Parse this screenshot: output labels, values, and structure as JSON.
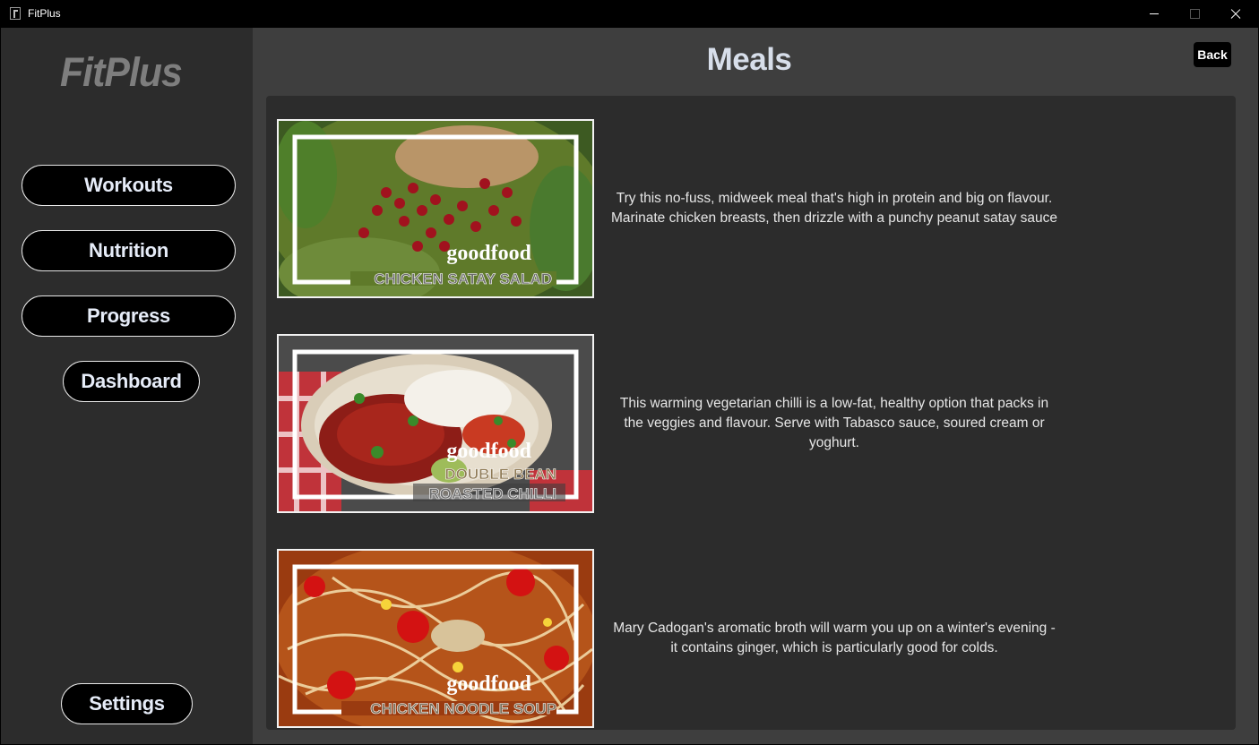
{
  "window": {
    "title": "FitPlus"
  },
  "sidebar": {
    "logo": "FitPlus",
    "items": [
      {
        "label": "Workouts"
      },
      {
        "label": "Nutrition"
      },
      {
        "label": "Progress"
      },
      {
        "label": "Dashboard"
      }
    ],
    "settings_label": "Settings"
  },
  "main": {
    "title": "Meals",
    "back_label": "Back",
    "meals": [
      {
        "brand": "goodfood",
        "image_caption": "CHICKEN SATAY SALAD",
        "description": "Try this no-fuss, midweek meal that's high in protein and big on flavour. Marinate chicken breasts, then drizzle with a punchy peanut satay sauce"
      },
      {
        "brand": "goodfood",
        "image_caption_line1": "DOUBLE BEAN",
        "image_caption_line2": "ROASTED CHILLI",
        "description": "This warming vegetarian chilli is a low-fat, healthy option that packs in the veggies and flavour. Serve with Tabasco sauce, soured cream or yoghurt."
      },
      {
        "brand": "goodfood",
        "image_caption": "CHICKEN NOODLE SOUP",
        "description": "Mary Cadogan's aromatic broth will warm you up on a winter's evening - it contains ginger, which is particularly good for colds."
      }
    ]
  }
}
